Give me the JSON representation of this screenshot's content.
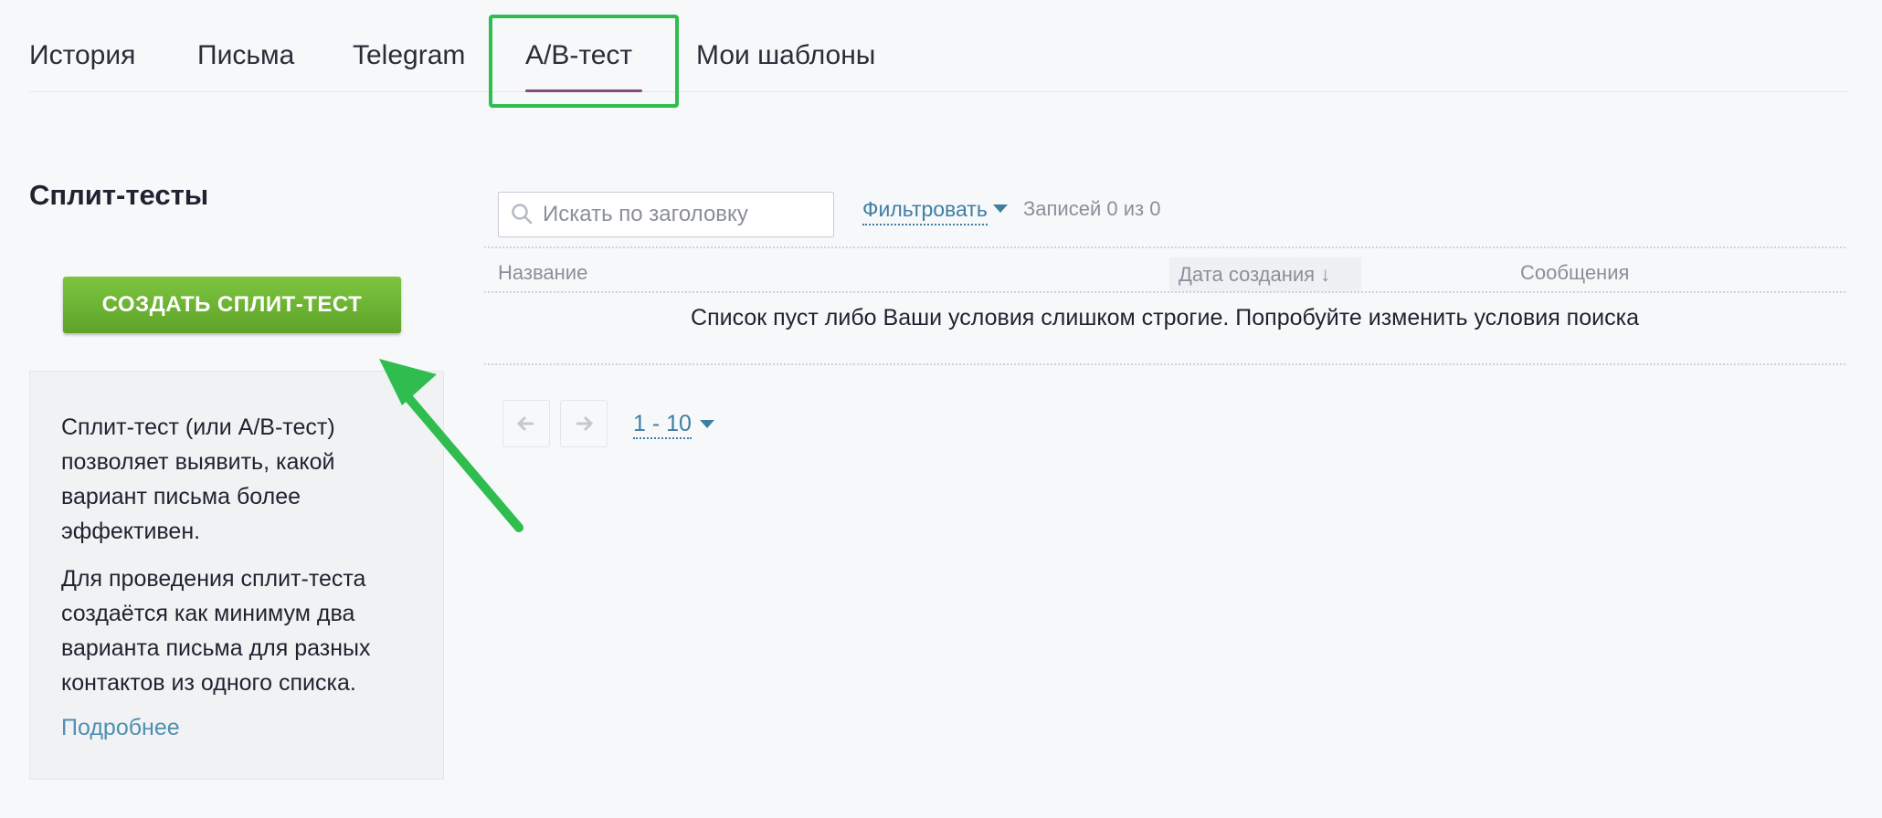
{
  "tabs": [
    {
      "label": "История",
      "active": false
    },
    {
      "label": "Письма",
      "active": false
    },
    {
      "label": "Telegram",
      "active": false
    },
    {
      "label": "A/B-тест",
      "active": true
    },
    {
      "label": "Мои шаблоны",
      "active": false
    }
  ],
  "sidebar": {
    "title": "Сплит-тесты",
    "create_button": "СОЗДАТЬ СПЛИТ-ТЕСТ",
    "info_paragraphs": [
      "Сплит-тест (или A/B-тест) позволяет выявить, какой вариант письма более эффективен.",
      "Для проведения сплит-теста создаётся как минимум два варианта письма для разных контактов из одного списка."
    ],
    "info_link": "Подробнее"
  },
  "toolbar": {
    "search_placeholder": "Искать по заголовку",
    "search_value": "",
    "filter_label": "Фильтровать",
    "records_text": "Записей 0 из 0"
  },
  "table": {
    "columns": [
      "Название",
      "Дата создания ↓",
      "Сообщения"
    ],
    "empty_message": "Список пуст либо Ваши условия слишком строгие. Попробуйте изменить условия поиска"
  },
  "pagination": {
    "prev_icon": "arrow-left-icon",
    "next_icon": "arrow-right-icon",
    "range_label": "1 - 10"
  },
  "colors": {
    "accent_link": "#3f7ea3",
    "button_green": "#6db535",
    "highlight_green": "#2ebd4e",
    "tab_underline": "#8a4a7e"
  }
}
